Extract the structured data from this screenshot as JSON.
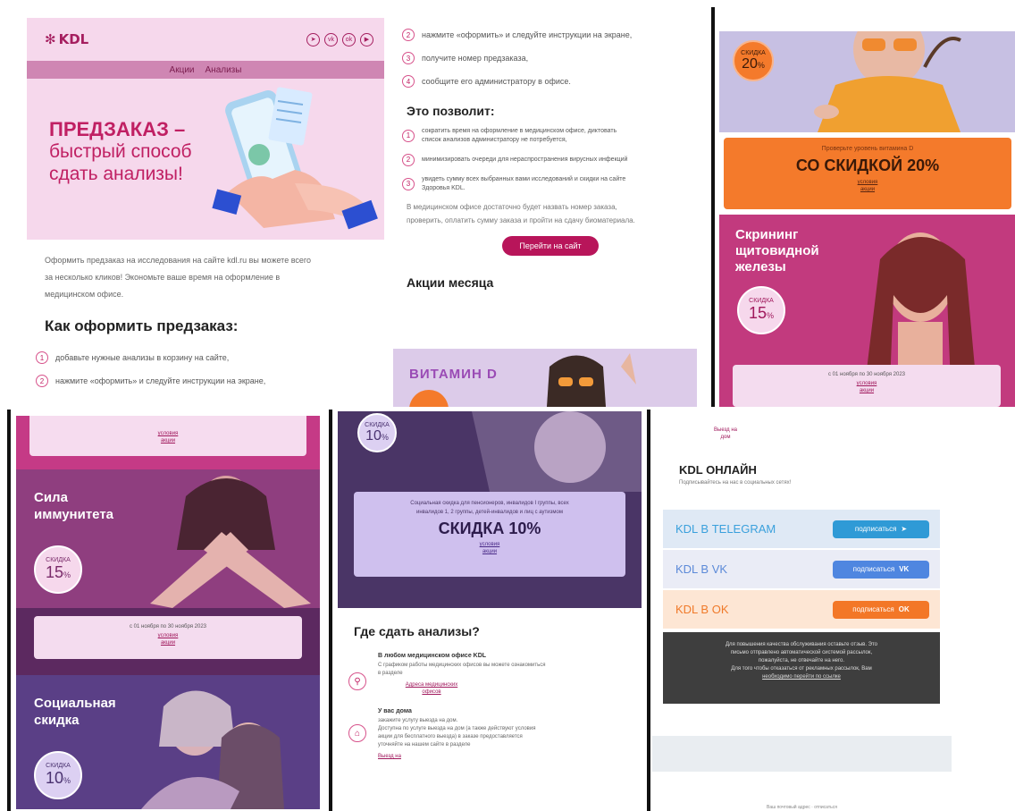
{
  "panel1": {
    "logo": "KDL",
    "socials": [
      "tg",
      "vk",
      "ok",
      "yt"
    ],
    "nav": [
      "Акции",
      "Анализы"
    ],
    "hero_title": "ПРЕДЗАКАЗ –",
    "hero_sub1": "быстрый способ",
    "hero_sub2": "сдать анализы!",
    "intro1": "Оформить предзаказ на исследования на сайте kdl.ru вы можете всего",
    "intro2": "за несколько кликов! Экономьте ваше время на оформление в",
    "intro3": "медицинском офисе.",
    "how_title": "Как оформить предзаказ:",
    "steps": [
      {
        "n": "1",
        "t": "добавьте нужные анализы в корзину на сайте,"
      },
      {
        "n": "2",
        "t": "нажмите «оформить» и следуйте инструкции на экране,"
      }
    ]
  },
  "panel2": {
    "steps": [
      {
        "n": "2",
        "t": "нажмите «оформить» и следуйте инструкции на экране,"
      },
      {
        "n": "3",
        "t": "получите номер предзаказа,"
      },
      {
        "n": "4",
        "t": "сообщите его администратору в офисе."
      }
    ],
    "benefits_title": "Это позволит:",
    "benefits": [
      {
        "n": "1",
        "t1": "сократить время на оформление в медицинском офисе, диктовать",
        "t2": "список анализов администратору не потребуется,"
      },
      {
        "n": "2",
        "t1": "минимизировать очереди для нераспространения вирусных инфекций",
        "t2": ""
      },
      {
        "n": "3",
        "t1": "увидеть сумму всех выбранных вами исследований и скидки на сайте",
        "t2": "Здоровья KDL."
      }
    ],
    "note1": "В медицинском офисе достаточно будет назвать номер заказа,",
    "note2": "проверить, оплатить сумму заказа и пройти на сдачу биоматериала.",
    "button": "Перейти на сайт",
    "month_title": "Акции месяца",
    "vit_title": "ВИТАМИН D",
    "vit_letter": "D"
  },
  "panel3": {
    "badge_label": "СКИДКА",
    "badge_val": "20",
    "badge_unit": "%",
    "promo_small": "Проверьте уровень витамина D",
    "promo_big": "СО СКИДКОЙ 20%",
    "link1": "условия",
    "link2": "акции",
    "scr_title": "Скрининг щитовидной железы",
    "scr_badge_label": "СКИДКА",
    "scr_badge_val": "15",
    "scr_badge_unit": "%",
    "date": "с 01 ноября по 30 ноября 2023",
    "date_link1": "условия",
    "date_link2": "акции"
  },
  "panel4": {
    "link1": "условия",
    "link2": "акции",
    "imm_title": "Сила иммунитета",
    "imm_badge_label": "СКИДКА",
    "imm_badge_val": "15",
    "imm_badge_unit": "%",
    "date": "с 01 ноября по 30 ноября 2023",
    "date_link1": "условия",
    "date_link2": "акции",
    "soc_title": "Социальная скидка",
    "soc_badge_label": "СКИДКА",
    "soc_badge_val": "10",
    "soc_badge_unit": "%"
  },
  "panel5": {
    "badge_label": "СКИДКА",
    "badge_val": "10",
    "badge_unit": "%",
    "box_small1": "Социальная скидка для пенсионеров, инвалидов I группы, всех",
    "box_small2": "инвалидов 1, 2 группы, детей-инвалидов и лиц с аутизмом",
    "box_big": "СКИДКА 10%",
    "link1": "условия",
    "link2": "акции",
    "where_title": "Где сдать анализы?",
    "office_title": "В любом медицинском офисе KDL",
    "office_text1": "С графиком работы медицинских офисов вы можете ознакомиться",
    "office_text2": "в разделе",
    "office_link1": "Адреса медицинских",
    "office_link2": "офисов",
    "home_title": "У вас дома",
    "home_text1": "закажите услугу выезда на дом.",
    "home_text2": "Доступна по услуге выезда на дом (а также действуют условия",
    "home_text3": "акции для бесплатного выезда) в заказе предоставляется",
    "home_text4": "уточняйте на нашем сайте в разделе",
    "home_link": "Выезд на"
  },
  "panel6": {
    "top_link1": "Выезд на",
    "top_link2": "дом",
    "title": "KDL ОНЛАЙН",
    "sub": "Подписывайтесь на нас в социальных сетях!",
    "rows": [
      {
        "name": "KDL В TELEGRAM",
        "btn": "подписаться",
        "icon": "➤",
        "bg": "#dfe9f5",
        "nameColor": "#3aa0dc",
        "btnColor": "#2f9ad6"
      },
      {
        "name": "KDL В VK",
        "btn": "подписаться",
        "icon": "VK",
        "bg": "#eaecf6",
        "nameColor": "#5c8ad8",
        "btnColor": "#4f86e0"
      },
      {
        "name": "KDL В OK",
        "btn": "подписаться",
        "icon": "OK",
        "bg": "#fde6d4",
        "nameColor": "#f07a2a",
        "btnColor": "#f37727"
      }
    ],
    "footer1": "Для повышения качества обслуживания оставьте отзыв. Это",
    "footer2": "письмо отправлено автоматической системой рассылок,",
    "footer3": "пожалуйста, не отвечайте на него.",
    "footer4": "Для того чтобы отказаться от рекламных рассылок, Вам",
    "footer5": "необходимо перейти по ссылке",
    "bottom": "Ваш почтовый адрес · отписаться"
  }
}
